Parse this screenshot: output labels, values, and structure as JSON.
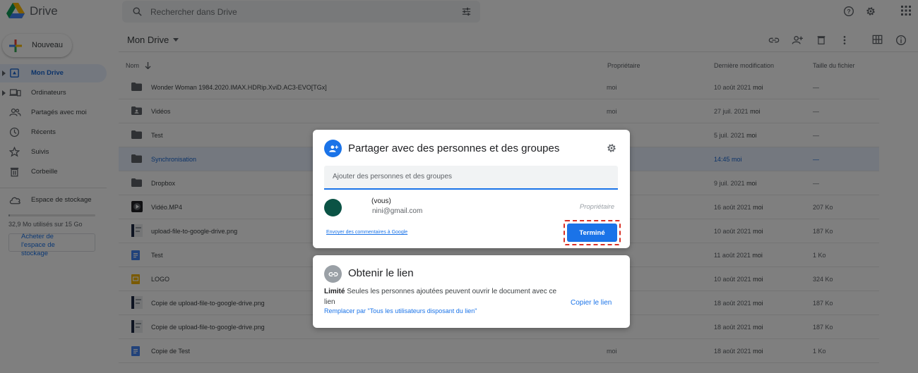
{
  "app": {
    "name": "Drive",
    "search_placeholder": "Rechercher dans Drive"
  },
  "sidebar": {
    "new_label": "Nouveau",
    "items": [
      {
        "label": "Mon Drive",
        "icon": "my-drive-icon",
        "active": true
      },
      {
        "label": "Ordinateurs",
        "icon": "computers-icon"
      },
      {
        "label": "Partagés avec moi",
        "icon": "shared-icon"
      },
      {
        "label": "Récents",
        "icon": "clock-icon"
      },
      {
        "label": "Suivis",
        "icon": "star-icon"
      },
      {
        "label": "Corbeille",
        "icon": "trash-icon"
      }
    ],
    "storage_label": "Espace de stockage",
    "storage_usage": "32,9 Mo utilisés sur 15 Go",
    "buy_storage": "Acheter de l'espace de stockage"
  },
  "main": {
    "title": "Mon Drive",
    "columns": {
      "name": "Nom",
      "owner": "Propriétaire",
      "modified": "Dernière modification",
      "size": "Taille du fichier"
    },
    "rows": [
      {
        "name": "Wonder Woman 1984.2020.IMAX.HDRip.XviD.AC3-EVO[TGx]",
        "type": "folder",
        "owner": "moi",
        "date": "10 août 2021",
        "by": "moi",
        "size": "—"
      },
      {
        "name": "Vidéos",
        "type": "shared-folder",
        "owner": "moi",
        "date": "27 juil. 2021",
        "by": "moi",
        "size": "—"
      },
      {
        "name": "Test",
        "type": "folder",
        "owner": "",
        "date": "5 juil. 2021",
        "by": "moi",
        "size": "—"
      },
      {
        "name": "Synchronisation",
        "type": "folder",
        "owner": "",
        "date": "14:45",
        "by": "moi",
        "size": "—",
        "selected": true
      },
      {
        "name": "Dropbox",
        "type": "folder",
        "owner": "",
        "date": "9 juil. 2021",
        "by": "moi",
        "size": "—"
      },
      {
        "name": "Vidéo.MP4",
        "type": "video",
        "owner": "",
        "date": "16 août 2021",
        "by": "moi",
        "size": "207 Ko"
      },
      {
        "name": "upload-file-to-google-drive.png",
        "type": "image",
        "owner": "",
        "date": "10 août 2021",
        "by": "moi",
        "size": "187 Ko"
      },
      {
        "name": "Test",
        "type": "doc",
        "owner": "",
        "date": "11 août 2021",
        "by": "moi",
        "size": "1 Ko"
      },
      {
        "name": "LOGO",
        "type": "slides",
        "owner": "",
        "date": "10 août 2021",
        "by": "moi",
        "size": "324 Ko"
      },
      {
        "name": "Copie de upload-file-to-google-drive.png",
        "type": "image",
        "owner": "",
        "date": "18 août 2021",
        "by": "moi",
        "size": "187 Ko"
      },
      {
        "name": "Copie de upload-file-to-google-drive.png",
        "type": "image",
        "owner": "",
        "date": "18 août 2021",
        "by": "moi",
        "size": "187 Ko"
      },
      {
        "name": "Copie de Test",
        "type": "doc",
        "owner": "moi",
        "date": "18 août 2021",
        "by": "moi",
        "size": "1 Ko"
      }
    ]
  },
  "share_dialog": {
    "title": "Partager avec des personnes et des groupes",
    "input_placeholder": "Ajouter des personnes et des groupes",
    "person_name": "(vous)",
    "person_email": "nini@gmail.com",
    "person_role": "Propriétaire",
    "feedback_link": "Envoyer des commentaires à Google",
    "done_label": "Terminé"
  },
  "link_dialog": {
    "title": "Obtenir le lien",
    "restriction": "Limité",
    "description": "Seules les personnes ajoutées peuvent ouvrir le document avec ce lien",
    "replace_link": "Remplacer par \"Tous les utilisateurs disposant du lien\"",
    "copy_link": "Copier le lien"
  },
  "colors": {
    "accent": "#1a73e8",
    "selected_bg": "#e8f0fe",
    "highlight": "#d93025",
    "avatar": "#0b5345"
  }
}
